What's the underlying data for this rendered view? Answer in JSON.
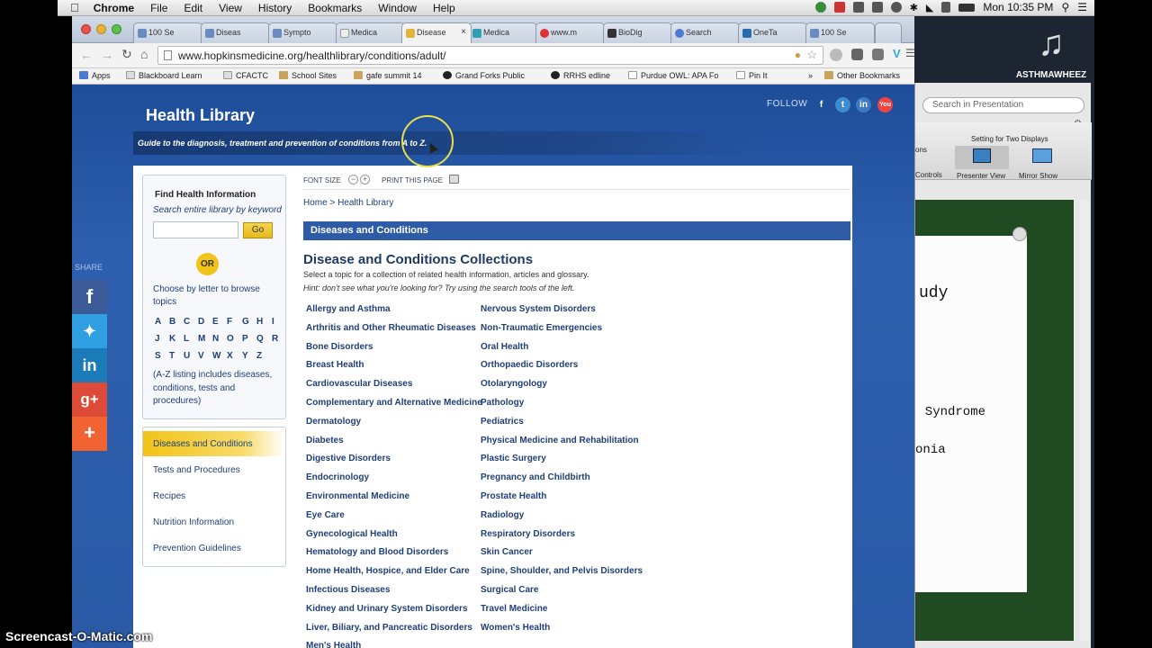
{
  "menubar": {
    "app": "Chrome",
    "items": [
      "File",
      "Edit",
      "View",
      "History",
      "Bookmarks",
      "Window",
      "Help"
    ],
    "clock": "Mon 10:35 PM"
  },
  "desktop": {
    "itunes_label": "ASTHMAWHEEZ"
  },
  "keynote": {
    "search_placeholder": "Search in Presentation",
    "side_labels": [
      "ons",
      "Controls"
    ],
    "toolbar_title": "Setting for Two Displays",
    "presenter_view": "Presenter View",
    "mirror_show": "Mirror Show",
    "slide_lines": [
      "udy",
      "; Syndrome",
      "onia"
    ]
  },
  "tabs": [
    {
      "label": "100 Se"
    },
    {
      "label": "Diseas"
    },
    {
      "label": "Sympto"
    },
    {
      "label": "Medica"
    },
    {
      "label": "Disease"
    },
    {
      "label": "Medica"
    },
    {
      "label": "www.m"
    },
    {
      "label": "BioDig"
    },
    {
      "label": "Search"
    },
    {
      "label": "OneTa"
    },
    {
      "label": "100 Se"
    }
  ],
  "omnibox": {
    "url": "www.hopkinsmedicine.org/healthlibrary/conditions/adult/"
  },
  "bookmarks": [
    "Apps",
    "Blackboard Learn",
    "CFACTC",
    "School Sites",
    "gafe summit 14",
    "Grand Forks Public",
    "RRHS edline",
    "Purdue OWL: APA Fo",
    "Pin It"
  ],
  "other_bookmarks": "Other Bookmarks",
  "page": {
    "title": "Health Library",
    "follow": "FOLLOW",
    "tagline": "Guide to the diagnosis, treatment and prevention of conditions from A to Z.",
    "share": "SHARE",
    "font_size": "FONT SIZE",
    "print": "PRINT THIS PAGE",
    "breadcrumb": "Home > Health Library",
    "section_bar": "Diseases and Conditions",
    "heading": "Disease and Conditions Collections",
    "intro": "Select a topic for a collection of related health information, articles and glossary.",
    "hint": "Hint: don't see what you're looking for? Try using the search tools of the left.",
    "find_title": "Find Health Information",
    "find_sub": "Search entire library by keyword",
    "go": "Go",
    "or": "OR",
    "browse": "Choose by letter to browse topics",
    "letters": [
      "A",
      "B",
      "C",
      "D",
      "E",
      "F",
      "G",
      "H",
      "I",
      "J",
      "K",
      "L",
      "M",
      "N",
      "O",
      "P",
      "Q",
      "R",
      "S",
      "T",
      "U",
      "V",
      "W",
      "X",
      "Y",
      "Z"
    ],
    "az_note": "(A-Z listing includes diseases, conditions, tests and procedures)",
    "nav": [
      "Diseases and Conditions",
      "Tests and Procedures",
      "Recipes",
      "Nutrition Information",
      "Prevention Guidelines"
    ],
    "col1": [
      "Allergy and Asthma",
      "Arthritis and Other Rheumatic Diseases",
      "Bone Disorders",
      "Breast Health",
      "Cardiovascular Diseases",
      "Complementary and Alternative Medicine",
      "Dermatology",
      "Diabetes",
      "Digestive Disorders",
      "Endocrinology",
      "Environmental Medicine",
      "Eye Care",
      "Gynecological Health",
      "Hematology and Blood Disorders",
      "Home Health, Hospice, and Elder Care",
      "Infectious Diseases",
      "Kidney and Urinary System Disorders",
      "Liver, Biliary, and Pancreatic Disorders",
      "Men's Health"
    ],
    "col2": [
      "Nervous System Disorders",
      "Non-Traumatic Emergencies",
      "Oral Health",
      "Orthopaedic Disorders",
      "Otolaryngology",
      "Pathology",
      "Pediatrics",
      "Physical Medicine and Rehabilitation",
      "Plastic Surgery",
      "Pregnancy and Childbirth",
      "Prostate Health",
      "Radiology",
      "Respiratory Disorders",
      "Skin Cancer",
      "Spine, Shoulder, and Pelvis Disorders",
      "Surgical Care",
      "Travel Medicine",
      "Women's Health"
    ]
  },
  "watermark": "Screencast-O-Matic.com",
  "colors": {
    "brand_blue": "#2a5aa6",
    "accent_yellow": "#f2c318",
    "link": "#1f3f77"
  }
}
